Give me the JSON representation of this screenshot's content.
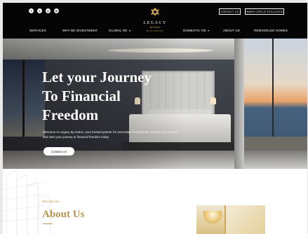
{
  "header": {
    "social_icons": [
      "facebook-icon",
      "twitter-icon",
      "instagram-icon",
      "linkedin-icon"
    ],
    "logo": {
      "name": "LEGACY",
      "by": "by Grace",
      "tagline": "RIYA GROUP"
    },
    "contact_button": "CONTACT US",
    "inner_circle_button": "INNER CIRCLE EXCLUSIVE",
    "nav": [
      {
        "label": "SERVICES",
        "dropdown": false
      },
      {
        "label": "WHY BE INVESTMENT",
        "dropdown": false
      },
      {
        "label": "GLOBAL RE",
        "dropdown": true
      },
      {
        "label": "DOMESTIC RE",
        "dropdown": true
      },
      {
        "label": "ABOUT US",
        "dropdown": false
      },
      {
        "label": "REMODELED HOMES",
        "dropdown": false
      }
    ]
  },
  "hero": {
    "title_lines": [
      "Let your Journey",
      "To Financial",
      "Freedom"
    ],
    "description": "Welcome to Legacy By Grace, your trusted partner for real estate investments. Explore our services and start your journey to financial freedom today.",
    "cta_label": "Contact Us"
  },
  "about": {
    "eyebrow": "Who We Are",
    "title": "About Us"
  },
  "colors": {
    "header_bg": "#050505",
    "accent_gold": "#b89652",
    "hero_text": "#ffffff"
  }
}
